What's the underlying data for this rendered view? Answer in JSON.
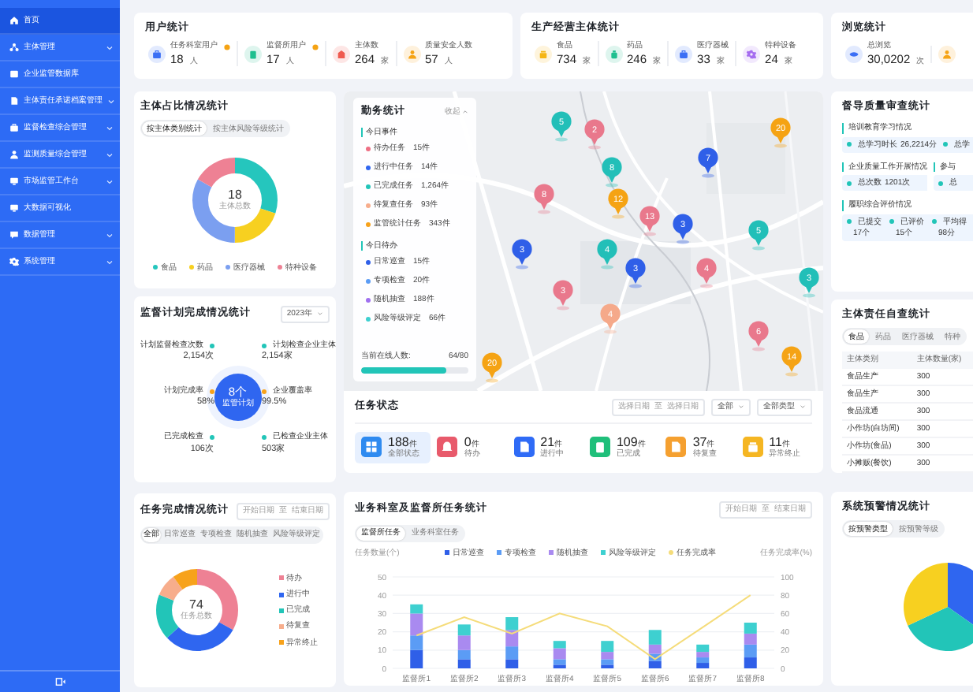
{
  "sidebar": {
    "items": [
      {
        "label": "首页",
        "selected": true,
        "expandable": false
      },
      {
        "label": "主体管理",
        "selected": false,
        "expandable": true
      },
      {
        "label": "企业监管数据库",
        "selected": false,
        "expandable": false
      },
      {
        "label": "主体责任承诺档案管理",
        "selected": false,
        "expandable": true
      },
      {
        "label": "监督检查综合管理",
        "selected": false,
        "expandable": true
      },
      {
        "label": "监测质量综合管理",
        "selected": false,
        "expandable": true
      },
      {
        "label": "市场监管工作台",
        "selected": false,
        "expandable": true
      },
      {
        "label": "大数据可视化",
        "selected": false,
        "expandable": false
      },
      {
        "label": "数据管理",
        "selected": false,
        "expandable": true
      },
      {
        "label": "系统管理",
        "selected": false,
        "expandable": true
      }
    ]
  },
  "user_stats": {
    "title": "用户统计",
    "items": [
      {
        "label": "任务科室用户",
        "value": "18",
        "unit": "人",
        "info": true,
        "color": "#3b6ff5"
      },
      {
        "label": "监督所用户",
        "value": "17",
        "unit": "人",
        "info": true,
        "color": "#1fbf8f"
      },
      {
        "label": "主体数",
        "value": "264",
        "unit": "家",
        "info": false,
        "color": "#ef5a4f"
      },
      {
        "label": "质量安全人数",
        "value": "57",
        "unit": "人",
        "info": false,
        "color": "#f5a314"
      }
    ]
  },
  "production_stats": {
    "title": "生产经营主体统计",
    "items": [
      {
        "label": "食品",
        "value": "734",
        "unit": "家",
        "color": "#f5b514"
      },
      {
        "label": "药品",
        "value": "246",
        "unit": "家",
        "color": "#1fbf8f"
      },
      {
        "label": "医疗器械",
        "value": "33",
        "unit": "家",
        "color": "#3b6ff5"
      },
      {
        "label": "特种设备",
        "value": "24",
        "unit": "家",
        "color": "#a56cf0"
      }
    ]
  },
  "view_stats": {
    "title": "浏览统计",
    "items": [
      {
        "label": "总浏览",
        "value": "30,0202",
        "unit": "次",
        "color": "#3b6ff5"
      },
      {
        "color": "#f5a314"
      }
    ]
  },
  "subject_ratio": {
    "title": "主体占比情况统计",
    "tabs": [
      {
        "label": "按主体类别统计",
        "selected": true
      },
      {
        "label": "按主体风险等级统计",
        "selected": false
      }
    ],
    "total": "18",
    "total_label": "主体总数",
    "legend": [
      {
        "label": "食品",
        "color": "#25c6bd"
      },
      {
        "label": "药品",
        "color": "#f7d020"
      },
      {
        "label": "医疗器械",
        "color": "#7b9ff0"
      },
      {
        "label": "特种设备",
        "color": "#ee8194"
      }
    ]
  },
  "plan_stats": {
    "title": "监督计划完成情况统计",
    "year": "2023年",
    "center_value": "8个",
    "center_label": "监管计划",
    "items": [
      {
        "label": "计划监督检查次数",
        "value": "2,154次",
        "color": "#22c5b8"
      },
      {
        "label": "计划检查企业主体",
        "value": "2,154家",
        "color": "#22c5b8"
      },
      {
        "label": "计划完成率",
        "value": "58%",
        "color": "#f7a21b"
      },
      {
        "label": "企业覆盖率",
        "value": "99.5%",
        "color": "#f7a21b"
      },
      {
        "label": "已完成检查",
        "value": "106次",
        "color": "#22c5b8"
      },
      {
        "label": "已检查企业主体",
        "value": "503家",
        "color": "#22c5b8"
      }
    ]
  },
  "task_completion": {
    "title": "任务完成情况统计",
    "date_range": {
      "start_placeholder": "开始日期",
      "separator": "至",
      "end_placeholder": "结束日期"
    },
    "tabs": [
      {
        "label": "全部",
        "selected": true
      },
      {
        "label": "日常巡查",
        "selected": false
      },
      {
        "label": "专项检查",
        "selected": false
      },
      {
        "label": "随机抽查",
        "selected": false
      },
      {
        "label": "风险等级评定",
        "selected": false
      }
    ],
    "total": "74",
    "total_label": "任务总数",
    "legend": [
      {
        "label": "待办",
        "color": "#ee8194"
      },
      {
        "label": "进行中",
        "color": "#2f66f0"
      },
      {
        "label": "已完成",
        "color": "#22c5b8"
      },
      {
        "label": "待复查",
        "color": "#f7ad8c"
      },
      {
        "label": "异常终止",
        "color": "#f7a21b"
      }
    ]
  },
  "duty_stats": {
    "title": "勤务统计",
    "toggle": "收起",
    "sections": [
      {
        "title": "今日事件",
        "items": [
          {
            "label": "待办任务",
            "value": "15件",
            "color": "#ee6f84"
          },
          {
            "label": "进行中任务",
            "value": "14件",
            "color": "#2f66f0"
          },
          {
            "label": "已完成任务",
            "value": "1,264件",
            "color": "#22c5b8"
          },
          {
            "label": "待复查任务",
            "value": "93件",
            "color": "#f7ad8c"
          },
          {
            "label": "监管统计任务",
            "value": "343件",
            "color": "#f7a21b"
          }
        ]
      },
      {
        "title": "今日待办",
        "items": [
          {
            "label": "日常巡查",
            "value": "15件",
            "color": "#2f5fe8"
          },
          {
            "label": "专项检查",
            "value": "20件",
            "color": "#5b9cf5"
          },
          {
            "label": "随机抽查",
            "value": "188件",
            "color": "#a070f0"
          },
          {
            "label": "风险等级评定",
            "value": "66件",
            "color": "#3ed0d0"
          }
        ]
      }
    ],
    "online": {
      "label": "当前在线人数:",
      "value": "64/80",
      "level": 0.8
    }
  },
  "map": {
    "markers": [
      {
        "count": "5",
        "color": "#22bfb8"
      },
      {
        "count": "2",
        "color": "#e9788c"
      },
      {
        "count": "20",
        "color": "#f5a314"
      },
      {
        "count": "7",
        "color": "#2f5fe8"
      },
      {
        "count": "8",
        "color": "#22bfb8"
      },
      {
        "count": "8",
        "color": "#e9788c"
      },
      {
        "count": "12",
        "color": "#f5a314"
      },
      {
        "count": "13",
        "color": "#e9788c"
      },
      {
        "count": "3",
        "color": "#2f5fe8"
      },
      {
        "count": "5",
        "color": "#22bfb8"
      },
      {
        "count": "3",
        "color": "#2f5fe8"
      },
      {
        "count": "4",
        "color": "#22bfb8"
      },
      {
        "count": "4",
        "color": "#e9788c"
      },
      {
        "count": "3",
        "color": "#2f5fe8"
      },
      {
        "count": "3",
        "color": "#22bfb8"
      },
      {
        "count": "3",
        "color": "#e9788c"
      },
      {
        "count": "4",
        "color": "#f5a98a"
      },
      {
        "count": "6",
        "color": "#e9788c"
      },
      {
        "count": "14",
        "color": "#f5a314"
      },
      {
        "count": "20",
        "color": "#f5a314"
      }
    ]
  },
  "task_status": {
    "title": "任务状态",
    "date_range": {
      "start_placeholder": "选择日期",
      "separator": "至",
      "end_placeholder": "选择日期"
    },
    "selects": [
      "全部",
      "全部类型"
    ],
    "items": [
      {
        "value": "188",
        "unit": "件",
        "label": "全部状态",
        "selected": true,
        "color": "#2f8bf0"
      },
      {
        "value": "0",
        "unit": "件",
        "label": "待办",
        "selected": false,
        "color": "#e85a6b"
      },
      {
        "value": "21",
        "unit": "件",
        "label": "进行中",
        "selected": false,
        "color": "#2f6bf6"
      },
      {
        "value": "109",
        "unit": "件",
        "label": "已完成",
        "selected": false,
        "color": "#1fbf7a"
      },
      {
        "value": "37",
        "unit": "件",
        "label": "待复查",
        "selected": false,
        "color": "#f5a030"
      },
      {
        "value": "11",
        "unit": "件",
        "label": "异常终止",
        "selected": false,
        "color": "#f5b622"
      }
    ]
  },
  "dept_tasks": {
    "title": "业务科室及监督所任务统计",
    "date_range": {
      "start_placeholder": "开始日期",
      "separator": "至",
      "end_placeholder": "结束日期"
    },
    "tabs": [
      {
        "label": "监督所任务",
        "selected": true
      },
      {
        "label": "业务科室任务",
        "selected": false
      }
    ],
    "chart_data": {
      "type": "bar",
      "stacked": true,
      "grid": true,
      "ylabel": "任务数量(个)",
      "y2label": "任务完成率(%)",
      "categories": [
        "监督所1",
        "监督所2",
        "监督所3",
        "监督所4",
        "监督所5",
        "监督所6",
        "监督所7",
        "监督所8"
      ],
      "ylim": [
        0,
        50
      ],
      "yticks": [
        0,
        10,
        20,
        30,
        40,
        50
      ],
      "y2lim": [
        0,
        100
      ],
      "y2ticks": [
        0,
        20,
        40,
        60,
        80,
        100
      ],
      "series": [
        {
          "name": "日常巡查",
          "color": "#2f5fe8",
          "values": [
            10,
            5,
            5,
            2,
            2,
            4,
            3,
            6
          ]
        },
        {
          "name": "专项检查",
          "color": "#5b9cf5",
          "values": [
            8,
            5,
            7,
            3,
            3,
            4,
            3,
            7
          ]
        },
        {
          "name": "随机抽查",
          "color": "#a98af0",
          "values": [
            12,
            8,
            9,
            6,
            4,
            5,
            3,
            6
          ]
        },
        {
          "name": "风险等级评定",
          "color": "#3ed0d0",
          "values": [
            5,
            6,
            7,
            4,
            6,
            8,
            4,
            6
          ]
        },
        {
          "name": "任务完成率",
          "color": "#f5dc7a",
          "type": "line",
          "axis": "y2",
          "values": [
            36,
            56,
            38,
            60,
            46,
            10,
            45,
            80
          ]
        }
      ]
    }
  },
  "quality_review": {
    "title": "督导质量审查统计",
    "sections": [
      {
        "title": "培训教育学习情况",
        "kind": "inline",
        "items": [
          {
            "label": "总学习时长",
            "value": "26,2214分"
          },
          {
            "label": "总学"
          }
        ]
      },
      {
        "title": "企业质量工作开展情况",
        "kind": "inline",
        "items": [
          {
            "label": "总次数",
            "value": "1201次"
          }
        ]
      },
      {
        "title": "参与",
        "kind": "inline",
        "items": [
          {
            "label": "总"
          }
        ]
      },
      {
        "title": "履职综合评价情况",
        "kind": "stacked",
        "items": [
          {
            "label": "已提交",
            "value": "17个"
          },
          {
            "label": "已评价",
            "value": "15个"
          },
          {
            "label": "平均得",
            "value": "98分"
          }
        ]
      }
    ]
  },
  "self_check": {
    "title": "主体责任自查统计",
    "tabs": [
      {
        "label": "食品",
        "selected": true
      },
      {
        "label": "药品",
        "selected": false
      },
      {
        "label": "医疗器械",
        "selected": false
      },
      {
        "label": "特种",
        "selected": false
      }
    ],
    "columns": [
      "主体类别",
      "主体数量(家)"
    ],
    "rows": [
      [
        "食品生产",
        "300"
      ],
      [
        "食品生产",
        "300"
      ],
      [
        "食品流通",
        "300"
      ],
      [
        "小作坊(白坊间)",
        "300"
      ],
      [
        "小作坊(食品)",
        "300"
      ],
      [
        "小摊贩(餐饮)",
        "300"
      ]
    ]
  },
  "warning_stats": {
    "title": "系统预警情况统计",
    "tabs": [
      {
        "label": "按预警类型",
        "selected": true
      },
      {
        "label": "按预警等级",
        "selected": false
      }
    ]
  }
}
